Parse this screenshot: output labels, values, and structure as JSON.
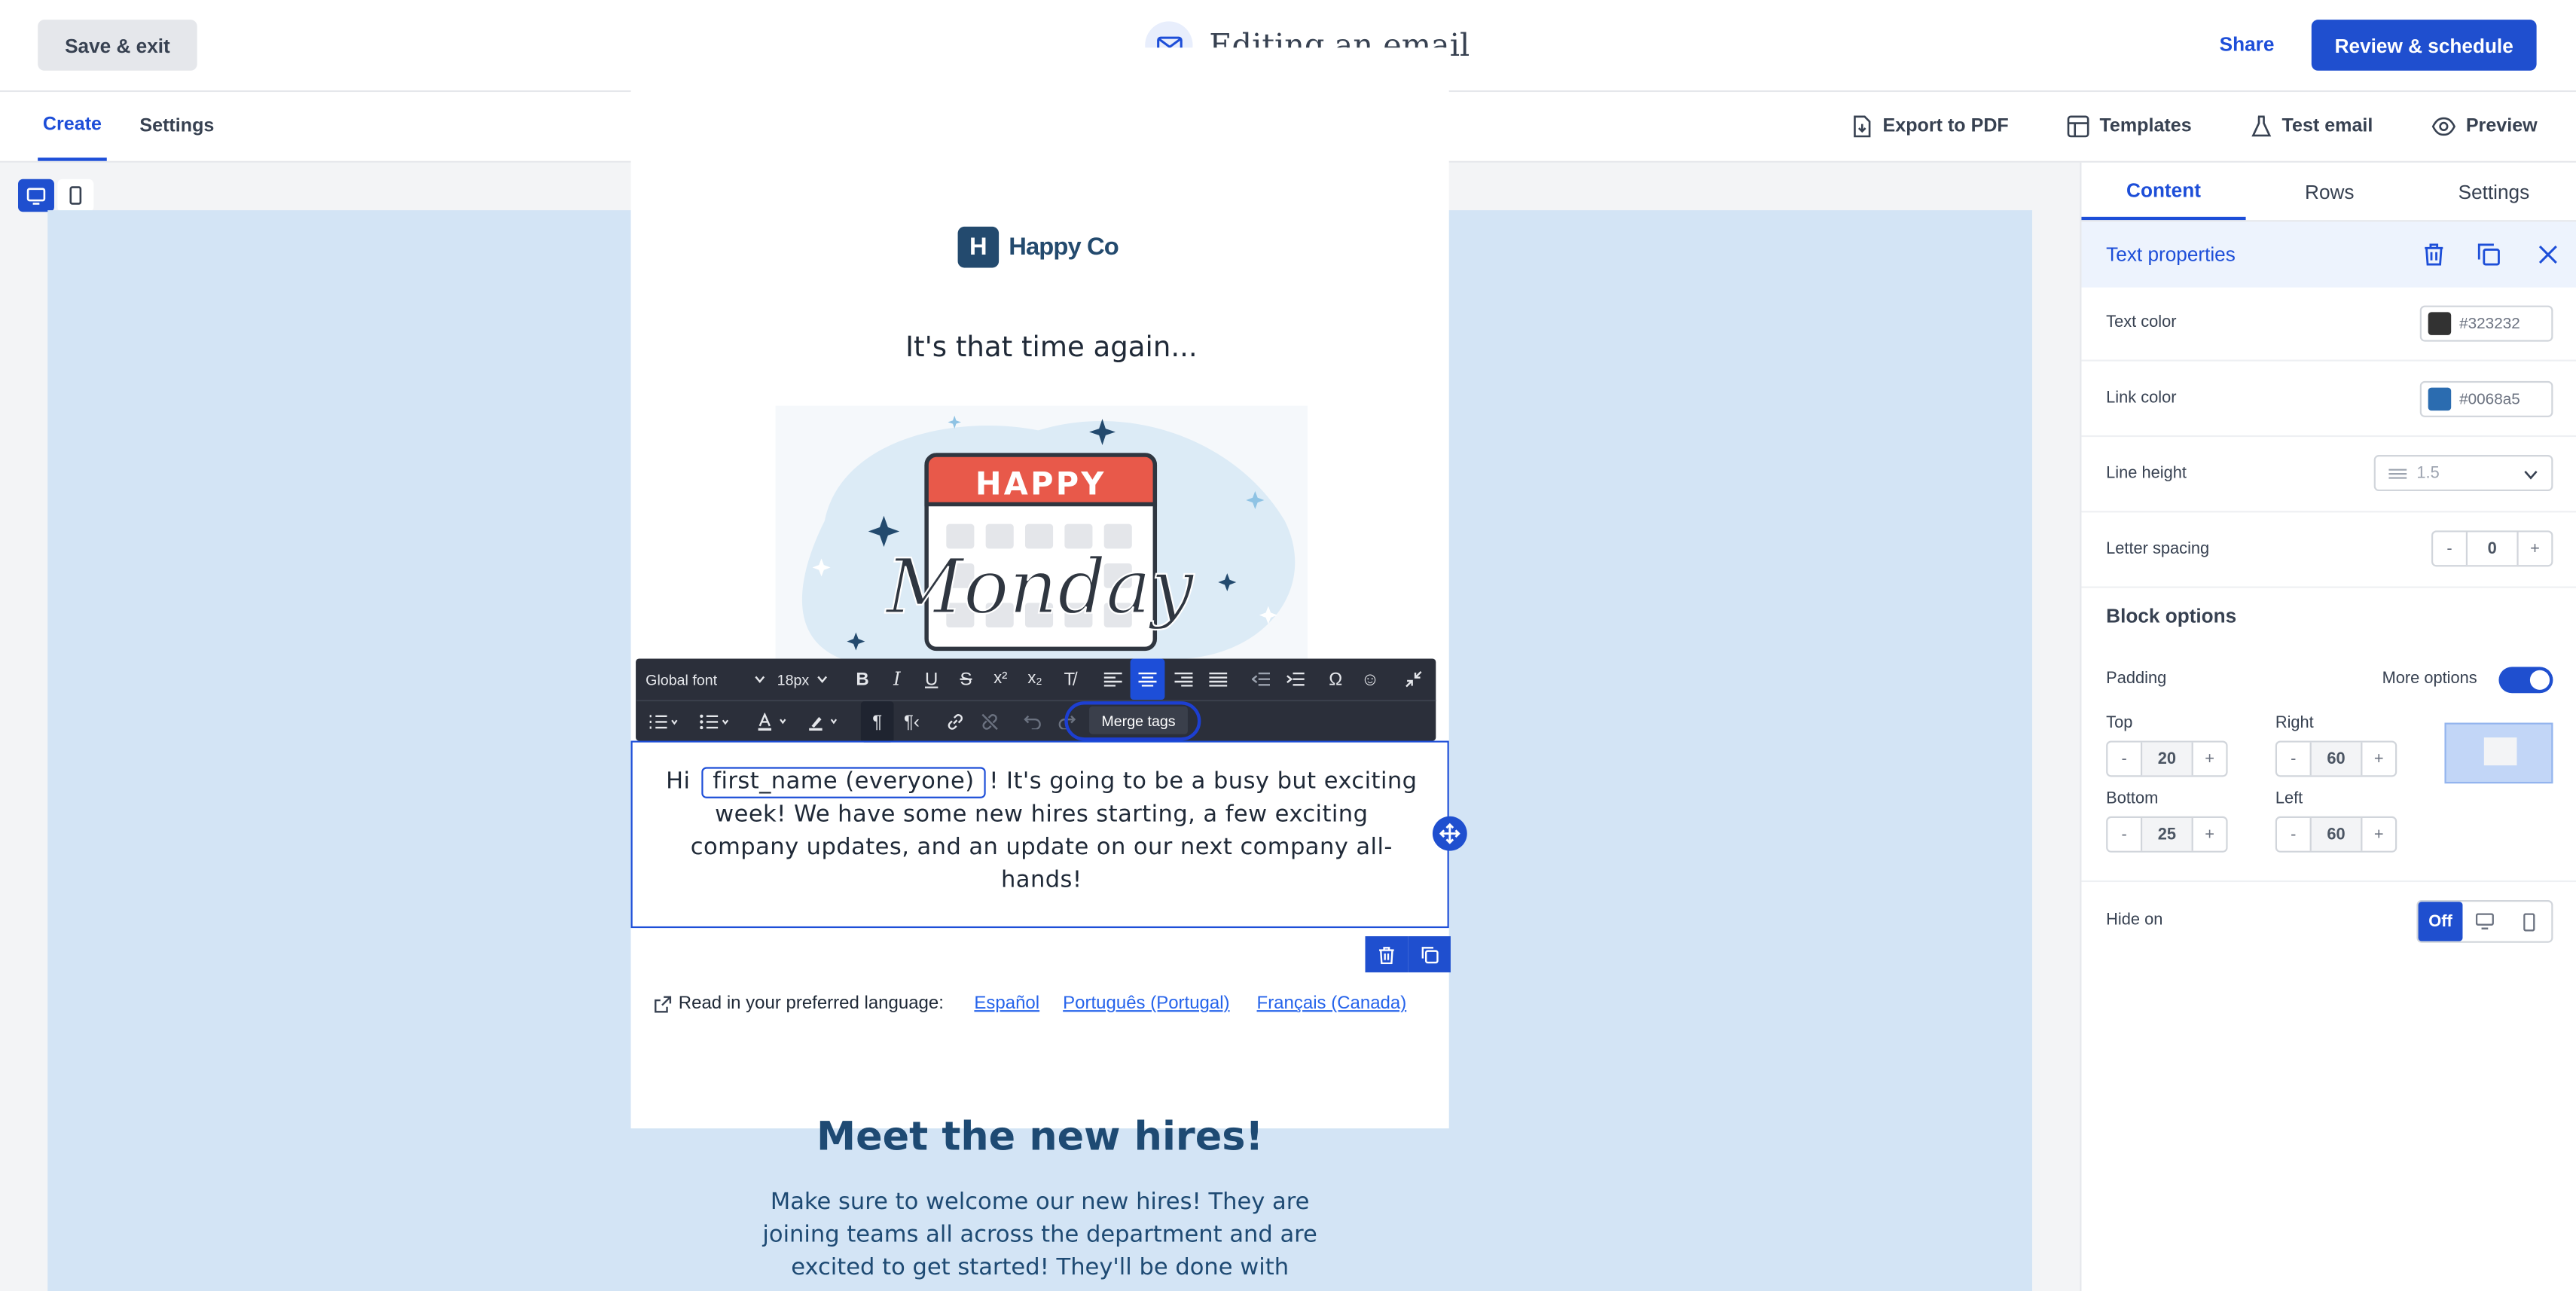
{
  "header": {
    "save_exit": "Save & exit",
    "title": "Editing an email",
    "share": "Share",
    "review": "Review & schedule"
  },
  "subnav": {
    "tabs": [
      "Create",
      "Settings"
    ],
    "tools": [
      "Export to PDF",
      "Templates",
      "Test email",
      "Preview"
    ]
  },
  "email": {
    "logo_letter": "H",
    "logo_name": "Happy Co",
    "headline": "It's that time again...",
    "hero": {
      "banner": "HAPPY",
      "script": "Monday"
    },
    "toolbar": {
      "font": "Global font",
      "size": "18px",
      "merge_tags": "Merge tags"
    },
    "body": {
      "greeting": "Hi",
      "merge_tag": "first_name (everyone)",
      "line1_rest": "! It's going to be a busy but exciting",
      "line2": "week! We have some new hires starting, a few exciting",
      "line3": "company updates, and an update on our next company all-",
      "line4": "hands!"
    },
    "language": {
      "label": "Read in your preferred language:",
      "links": [
        "Español",
        "Português (Portugal)",
        "Français (Canada)"
      ]
    },
    "section_title": "Meet the new hires!",
    "section_lines": [
      "Make sure to welcome our new hires! They are",
      "joining teams all across the department and are",
      "excited to get started! They'll be done with"
    ]
  },
  "panel": {
    "tabs": [
      "Content",
      "Rows",
      "Settings"
    ],
    "props_title": "Text properties",
    "text_color": {
      "label": "Text color",
      "value": "#323232",
      "swatch": "#323232"
    },
    "link_color": {
      "label": "Link color",
      "value": "#0068a5",
      "swatch": "#2b6cb0"
    },
    "line_height": {
      "label": "Line height",
      "value": "1.5"
    },
    "letter_spacing": {
      "label": "Letter spacing",
      "value": "0"
    },
    "block_options": "Block options",
    "padding": {
      "label": "Padding",
      "more_options": "More options",
      "top_label": "Top",
      "top": "20",
      "right_label": "Right",
      "right": "60",
      "bottom_label": "Bottom",
      "bottom": "25",
      "left_label": "Left",
      "left": "60"
    },
    "hide_on": {
      "label": "Hide on",
      "off": "Off"
    }
  },
  "colors": {
    "accent": "#1f4fcf",
    "canvas": "#d3e4f5",
    "heading": "#1e4a73"
  },
  "stepper_minus": "-",
  "stepper_plus": "+"
}
